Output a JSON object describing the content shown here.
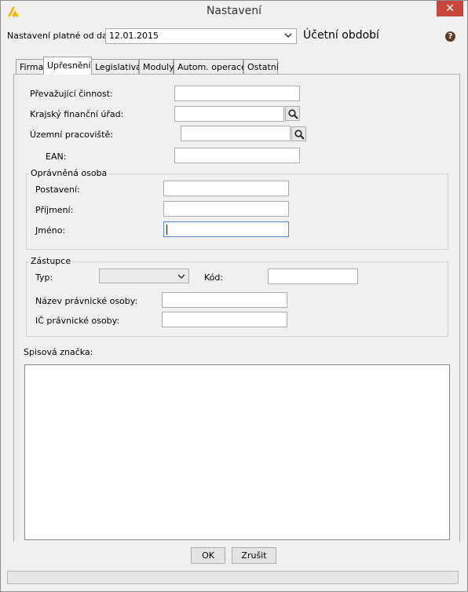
{
  "window": {
    "title": "Nastavení",
    "close_glyph": "✕",
    "app_icon": "app-logo-icon"
  },
  "top": {
    "valid_from_label": "Nastavení platné od data:",
    "valid_from_value": "12.01.2015",
    "period_label": "Účetní období",
    "help_glyph": "?"
  },
  "tabs": [
    {
      "label": "Firma"
    },
    {
      "label": "Upřesnění"
    },
    {
      "label": "Legislativa"
    },
    {
      "label": "Moduly"
    },
    {
      "label": "Autom. operace"
    },
    {
      "label": "Ostatní"
    }
  ],
  "active_tab": "Upřesnění",
  "form": {
    "activity_label": "Převažující činnost:",
    "tax_office_label": "Krajský finanční úřad:",
    "workplace_label": "Územní pracoviště:",
    "ean_label": "EAN:",
    "authorized": {
      "title": "Oprávněná osoba",
      "position_label": "Postavení:",
      "surname_label": "Příjmení:",
      "name_label": "Jméno:"
    },
    "representative": {
      "title": "Zástupce",
      "type_label": "Typ:",
      "code_label": "Kód:",
      "legal_name_label": "Název právnické osoby:",
      "legal_id_label": "IČ právnické osoby:"
    },
    "file_mark_label": "Spisová značka:"
  },
  "buttons": {
    "ok": "OK",
    "cancel": "Zrušit"
  }
}
